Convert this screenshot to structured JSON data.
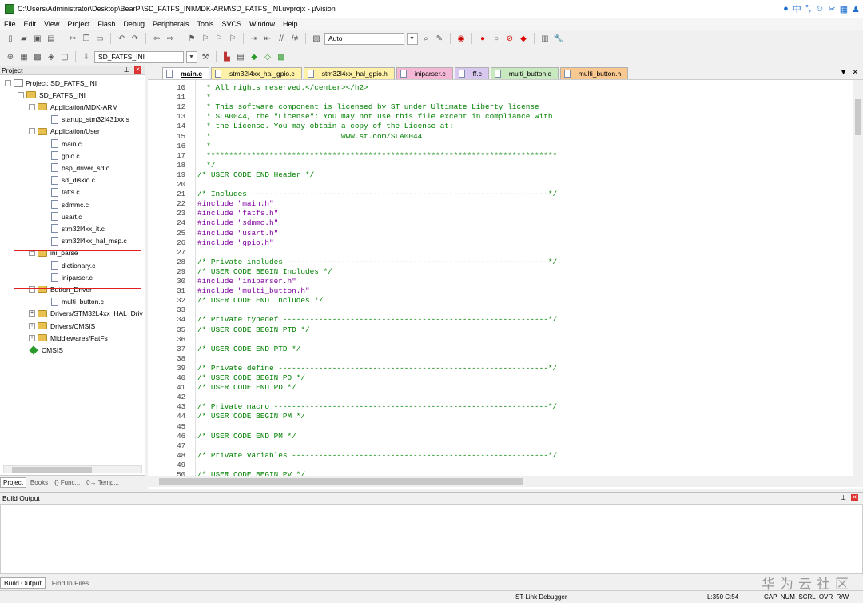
{
  "window": {
    "title": "C:\\Users\\Administrator\\Desktop\\BearPi\\SD_FATFS_INI\\MDK-ARM\\SD_FATFS_INI.uvprojx - µVision"
  },
  "menu": [
    "File",
    "Edit",
    "View",
    "Project",
    "Flash",
    "Debug",
    "Peripherals",
    "Tools",
    "SVCS",
    "Window",
    "Help"
  ],
  "toolbar": {
    "target_combo": "Auto",
    "target_name": "SD_FATFS_INI"
  },
  "project_panel": {
    "title": "Project",
    "tree": [
      {
        "label": "Project: SD_FATFS_INI",
        "level": 0,
        "kind": "project",
        "expander": "−"
      },
      {
        "label": "SD_FATFS_INI",
        "level": 1,
        "kind": "target",
        "expander": "−"
      },
      {
        "label": "Application/MDK-ARM",
        "level": 2,
        "kind": "folder",
        "expander": "−"
      },
      {
        "label": "startup_stm32l431xx.s",
        "level": 3,
        "kind": "file"
      },
      {
        "label": "Application/User",
        "level": 2,
        "kind": "folder",
        "expander": "−"
      },
      {
        "label": "main.c",
        "level": 3,
        "kind": "file"
      },
      {
        "label": "gpio.c",
        "level": 3,
        "kind": "file"
      },
      {
        "label": "bsp_driver_sd.c",
        "level": 3,
        "kind": "file"
      },
      {
        "label": "sd_diskio.c",
        "level": 3,
        "kind": "file"
      },
      {
        "label": "fatfs.c",
        "level": 3,
        "kind": "file"
      },
      {
        "label": "sdmmc.c",
        "level": 3,
        "kind": "file"
      },
      {
        "label": "usart.c",
        "level": 3,
        "kind": "file"
      },
      {
        "label": "stm32l4xx_it.c",
        "level": 3,
        "kind": "file"
      },
      {
        "label": "stm32l4xx_hal_msp.c",
        "level": 3,
        "kind": "file"
      },
      {
        "label": "ini_parse",
        "level": 2,
        "kind": "folder",
        "expander": "−"
      },
      {
        "label": "dictionary.c",
        "level": 3,
        "kind": "file"
      },
      {
        "label": "iniparser.c",
        "level": 3,
        "kind": "file"
      },
      {
        "label": "Button_Driver",
        "level": 2,
        "kind": "folder",
        "expander": "−"
      },
      {
        "label": "multi_button.c",
        "level": 3,
        "kind": "file"
      },
      {
        "label": "Drivers/STM32L4xx_HAL_Driv",
        "level": 2,
        "kind": "folder",
        "expander": "+"
      },
      {
        "label": "Drivers/CMSIS",
        "level": 2,
        "kind": "folder",
        "expander": "+"
      },
      {
        "label": "Middlewares/FatFs",
        "level": 2,
        "kind": "folder",
        "expander": "+"
      },
      {
        "label": "CMSIS",
        "level": 2,
        "kind": "component"
      }
    ],
    "tabs": [
      "Project",
      "Books",
      "{} Func...",
      "0→ Temp..."
    ]
  },
  "editor": {
    "tabs": [
      {
        "label": "main.c",
        "color": "#ffffff",
        "active": true
      },
      {
        "label": "stm32l4xx_hal_gpio.c",
        "color": "#fff2a8"
      },
      {
        "label": "stm32l4xx_hal_gpio.h",
        "color": "#fff2a8"
      },
      {
        "label": "iniparser.c",
        "color": "#f4b8d6"
      },
      {
        "label": "ff.c",
        "color": "#d8c8f0"
      },
      {
        "label": "multi_button.c",
        "color": "#c8e8c0"
      },
      {
        "label": "multi_button.h",
        "color": "#f8c890"
      }
    ],
    "lines": [
      {
        "n": "10",
        "t": "  * All rights reserved.</center></h2>"
      },
      {
        "n": "11",
        "t": "  *"
      },
      {
        "n": "12",
        "t": "  * This software component is licensed by ST under Ultimate Liberty license"
      },
      {
        "n": "13",
        "t": "  * SLA0044, the \"License\"; You may not use this file except in compliance with"
      },
      {
        "n": "14",
        "t": "  * the License. You may obtain a copy of the License at:"
      },
      {
        "n": "15",
        "t": "  *                             www.st.com/SLA0044"
      },
      {
        "n": "16",
        "t": "  *"
      },
      {
        "n": "17",
        "t": "  ******************************************************************************"
      },
      {
        "n": "18",
        "t": "  */"
      },
      {
        "n": "19",
        "t": "/* USER CODE END Header */"
      },
      {
        "n": "20",
        "t": ""
      },
      {
        "n": "21",
        "t": "/* Includes ------------------------------------------------------------------*/"
      },
      {
        "n": "22",
        "t": "#include \"main.h\"",
        "pp": true
      },
      {
        "n": "23",
        "t": "#include \"fatfs.h\"",
        "pp": true
      },
      {
        "n": "24",
        "t": "#include \"sdmmc.h\"",
        "pp": true
      },
      {
        "n": "25",
        "t": "#include \"usart.h\"",
        "pp": true
      },
      {
        "n": "26",
        "t": "#include \"gpio.h\"",
        "pp": true
      },
      {
        "n": "27",
        "t": ""
      },
      {
        "n": "28",
        "t": "/* Private includes ----------------------------------------------------------*/"
      },
      {
        "n": "29",
        "t": "/* USER CODE BEGIN Includes */"
      },
      {
        "n": "30",
        "t": "#include \"iniparser.h\"",
        "pp": true
      },
      {
        "n": "31",
        "t": "#include \"multi_button.h\"",
        "pp": true
      },
      {
        "n": "32",
        "t": "/* USER CODE END Includes */"
      },
      {
        "n": "33",
        "t": ""
      },
      {
        "n": "34",
        "t": "/* Private typedef -----------------------------------------------------------*/"
      },
      {
        "n": "35",
        "t": "/* USER CODE BEGIN PTD */"
      },
      {
        "n": "36",
        "t": ""
      },
      {
        "n": "37",
        "t": "/* USER CODE END PTD */"
      },
      {
        "n": "38",
        "t": ""
      },
      {
        "n": "39",
        "t": "/* Private define ------------------------------------------------------------*/"
      },
      {
        "n": "40",
        "t": "/* USER CODE BEGIN PD */"
      },
      {
        "n": "41",
        "t": "/* USER CODE END PD */"
      },
      {
        "n": "42",
        "t": ""
      },
      {
        "n": "43",
        "t": "/* Private macro -------------------------------------------------------------*/"
      },
      {
        "n": "44",
        "t": "/* USER CODE BEGIN PM */"
      },
      {
        "n": "45",
        "t": ""
      },
      {
        "n": "46",
        "t": "/* USER CODE END PM */"
      },
      {
        "n": "47",
        "t": ""
      },
      {
        "n": "48",
        "t": "/* Private variables ---------------------------------------------------------*/"
      },
      {
        "n": "49",
        "t": ""
      },
      {
        "n": "50",
        "t": "/* USER CODE BEGIN PV */"
      }
    ]
  },
  "build_output": {
    "title": "Build Output",
    "tabs": [
      "Build Output",
      "Find In Files"
    ]
  },
  "statusbar": {
    "debugger": "ST-Link Debugger",
    "position": "L:350 C:54",
    "flags": "CAP  NUM  SCRL  OVR  R/W"
  },
  "watermark": "华为云社区"
}
